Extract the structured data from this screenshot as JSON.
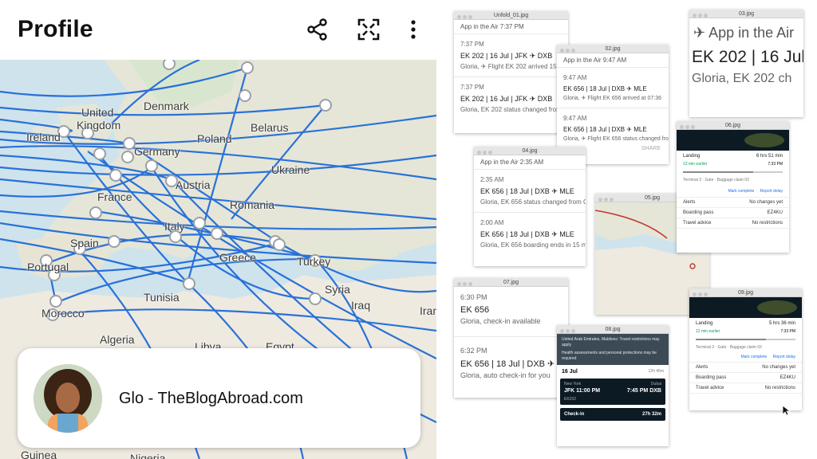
{
  "profile": {
    "title": "Profile",
    "icons": [
      "share-icon",
      "fullscreen-icon",
      "more-vert-icon"
    ],
    "name": "Glo - TheBlogAbroad.com"
  },
  "map": {
    "labels": {
      "denmark": "Denmark",
      "united_kingdom_1": "United",
      "united_kingdom_2": "Kingdom",
      "ireland": "Ireland",
      "belarus": "Belarus",
      "poland": "Poland",
      "germany": "Germany",
      "ukraine": "Ukraine",
      "france": "France",
      "austria": "Austria",
      "romania": "Romania",
      "italy": "Italy",
      "spain": "Spain",
      "portugal": "Portugal",
      "greece": "Greece",
      "turkey": "Turkey",
      "syria": "Syria",
      "iraq": "Iraq",
      "tunisia": "Tunisia",
      "morocco": "Morocco",
      "algeria": "Algeria",
      "libya": "Libya",
      "egypt": "Egypt",
      "iran": "Iran",
      "guinea": "Guinea",
      "nigeria": "Nigeria"
    },
    "colors": {
      "route": "#1565d8",
      "water": "#cfe3ec",
      "land": "#e8e4da"
    }
  },
  "collage": {
    "w1": {
      "title": "Unfold_01.jpg",
      "app": "App in the Air   7:37 PM",
      "n1_time": "7:37 PM",
      "n1_head": "EK 202 | 16 Jul | JFK ✈ DXB",
      "n1_body": "Gloria, ✈ Flight EK 202 arrived 15 min",
      "n2_time": "7:37 PM",
      "n2_head": "EK 202 | 16 Jul | JFK ✈ DXB",
      "n2_body": "Gloria, EK 202 status changed from En"
    },
    "w2": {
      "title": "02.jpg",
      "app": "App in the Air   9:47 AM",
      "n1_time": "9:47 AM",
      "n1_head": "EK 656 | 18 Jul | DXB ✈ MLE",
      "n1_body": "Gloria, ✈ Flight EK 656 arrived at 07:36",
      "n2_time": "9:47 AM",
      "n2_head": "EK 656 | 18 Jul | DXB ✈ MLE",
      "n2_body": "Gloria, ✈ Flight EK 656 status changed from en",
      "share": "SHARE"
    },
    "w3": {
      "title": "03.jpg",
      "app": "App in the Air",
      "head": "EK 202 | 16 Jul",
      "body": "Gloria, EK 202 ch"
    },
    "w4": {
      "title": "04.jpg",
      "app": "App in the Air   2:35 AM",
      "n1_time": "2:35 AM",
      "n1_head": "EK 656 | 18 Jul | DXB ✈ MLE",
      "n1_body": "Gloria, EK 656 status changed from On t",
      "n2_time": "2:00 AM",
      "n2_head": "EK 656 | 18 Jul | DXB ✈ MLE",
      "n2_body": "Gloria, EK 656 boarding ends in 15 min"
    },
    "w5": {
      "title": "05.jpg"
    },
    "w6": {
      "title": "06.jpg",
      "landing": "Landing",
      "earlier": "12 min earlier",
      "duration": "6 hrs 51 min",
      "time": "7:33 PM",
      "terminal": "Terminal 3 · Gate · Baggage claim 03",
      "mark": "Mark complete",
      "report": "Report delay",
      "alerts": "Alerts",
      "alerts_v": "No changes yet",
      "boarding": "Boarding pass",
      "boarding_v": "EZ4KU",
      "advice": "Travel advice",
      "advice_v": "No restrictions"
    },
    "w7": {
      "title": "07.jpg",
      "n1_time": "6:30 PM",
      "n1_head": "EK 656",
      "n1_body": "Gloria, check-in available",
      "n2_time": "6:32 PM",
      "n2_head": "EK 656 | 18 Jul | DXB ✈",
      "n2_body": "Gloria, auto check-in for you"
    },
    "w8": {
      "title": "08.jpg",
      "banner": "United Arab Emirates, Maldives: Travel restrictions may apply",
      "banner2": "Health assessments and personal protections may be required",
      "date": "16 Jul",
      "dur": "12h 45m",
      "from_city": "New York",
      "to_city": "Dubai",
      "dep": "JFK 11:00 PM",
      "arr": "7:45 PM DXB",
      "flight": "EK202",
      "checkin": "Check-in",
      "checkin_t": "27h 32m"
    },
    "w9": {
      "title": "09.jpg",
      "landing": "Landing",
      "earlier": "12 min earlier",
      "duration": "5 hrs 36 min",
      "time": "7:33 PM",
      "terminal": "Terminal 3 · Gate · Baggage claim 03",
      "mark": "Mark complete",
      "report": "Report delay",
      "alerts": "Alerts",
      "alerts_v": "No changes yet",
      "boarding": "Boarding pass",
      "boarding_v": "EZ4KU",
      "advice": "Travel advice",
      "advice_v": "No restrictions"
    }
  }
}
